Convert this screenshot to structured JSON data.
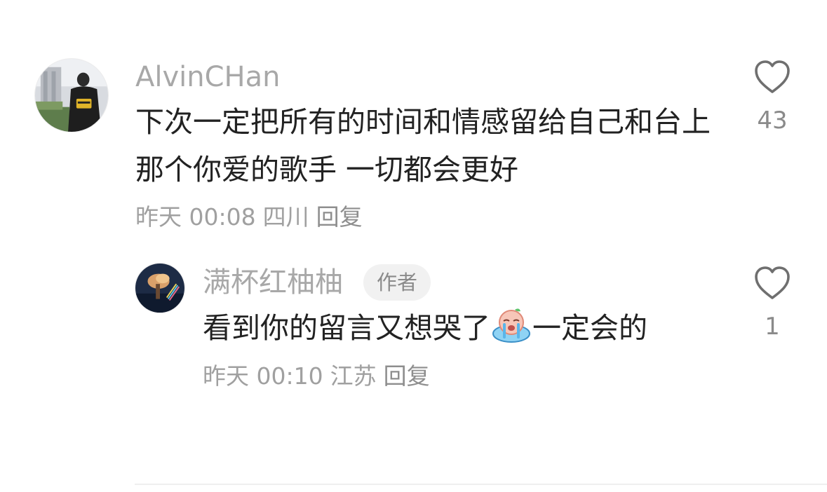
{
  "comment": {
    "username": "AlvinCHan",
    "text": "下次一定把所有的时间和情感留给自己和台上那个你爱的歌手 一切都会更好",
    "time": "昨天 00:08",
    "location": "四川",
    "reply_label": "回复",
    "like_count": "43",
    "like_icon": "heart-outline-icon"
  },
  "reply": {
    "username": "满杯红柚柚",
    "badge": "作者",
    "text_before_emoji": "看到你的留言又想哭了",
    "emoji": "crying-face-emoji",
    "text_after_emoji": "一定会的",
    "time": "昨天 00:10",
    "location": "江苏",
    "reply_label": "回复",
    "like_count": "1",
    "like_icon": "heart-outline-icon"
  },
  "colors": {
    "username": "#a8a8a8",
    "text": "#222222",
    "meta": "#a0a0a0",
    "badge_bg": "#f1f1f1",
    "icon": "#6f6f6f"
  }
}
